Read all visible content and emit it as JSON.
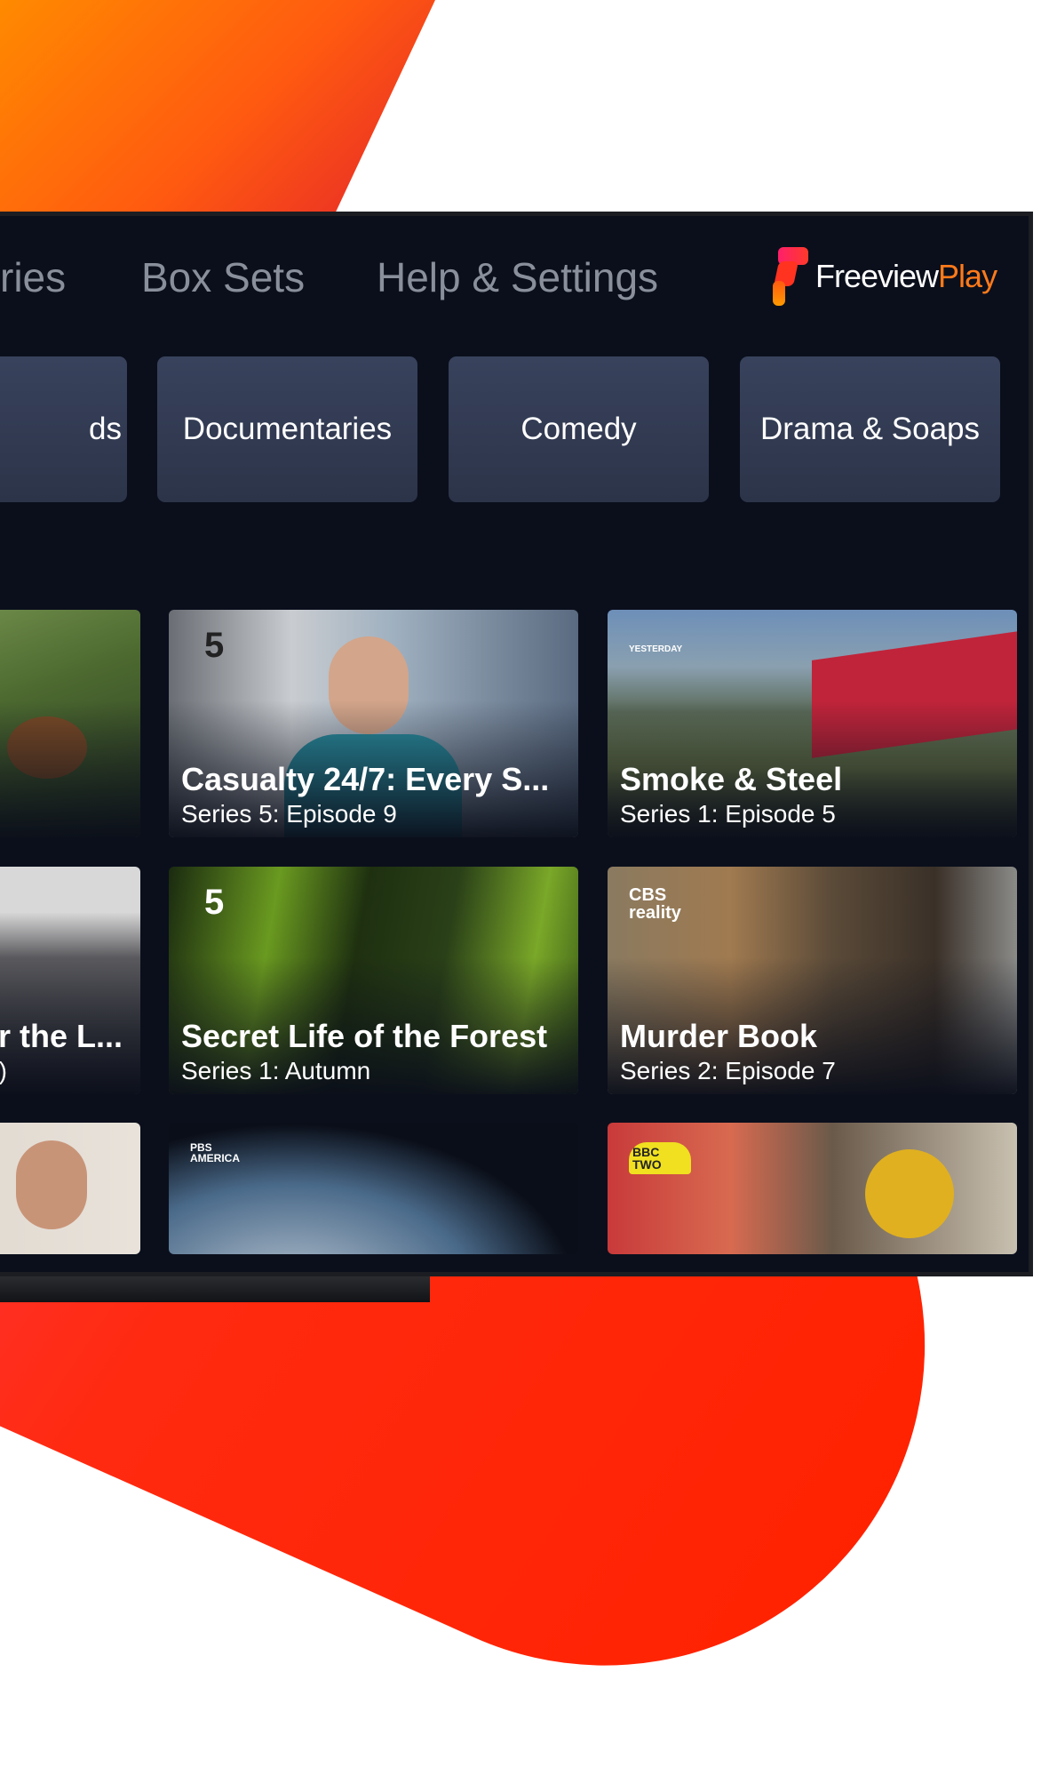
{
  "nav": {
    "items": [
      {
        "label": "ries"
      },
      {
        "label": "Box Sets"
      },
      {
        "label": "Help & Settings"
      }
    ]
  },
  "logo": {
    "text_main": "Freeview",
    "text_accent": "Play"
  },
  "categories": [
    {
      "label": "ds"
    },
    {
      "label": "Documentaries"
    },
    {
      "label": "Comedy"
    },
    {
      "label": "Drama & Soaps"
    }
  ],
  "rows": [
    [
      {
        "title": "",
        "subtitle": ""
      },
      {
        "title": "Casualty 24/7: Every S...",
        "subtitle": "Series 5: Episode 9",
        "channel": "5"
      },
      {
        "title": "Smoke & Steel",
        "subtitle": "Series 1: Episode 5",
        "channel": "YESTERDAY"
      }
    ],
    [
      {
        "title": "r the L...",
        "subtitle": ")"
      },
      {
        "title": "Secret Life of the Forest",
        "subtitle": "Series 1: Autumn",
        "channel": "5"
      },
      {
        "title": "Murder Book",
        "subtitle": "Series 2: Episode 7",
        "channel": "CBS reality"
      }
    ],
    [
      {
        "title": "",
        "subtitle": ""
      },
      {
        "title": "",
        "subtitle": "",
        "channel": "PBS AMERICA"
      },
      {
        "title": "",
        "subtitle": "",
        "channel": "BBC TWO"
      }
    ]
  ],
  "colors": {
    "screen": "#0b0f1c",
    "category_bg": "#323a52",
    "brand_orange": "#ff7a1a",
    "brand_red": "#ff2200"
  }
}
